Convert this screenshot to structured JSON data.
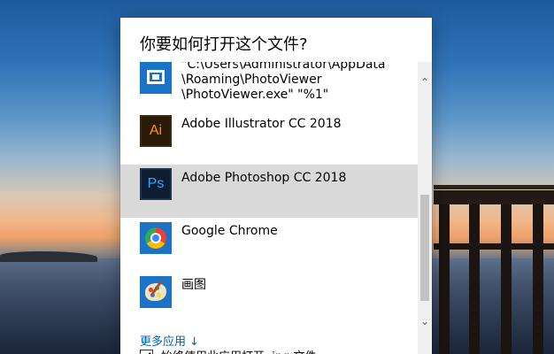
{
  "dialog": {
    "title": "你要如何打开这个文件?",
    "apps": [
      {
        "label_lines": [
          "\"C:\\Users\\Administrator\\AppData",
          "\\Roaming\\PhotoViewer",
          "\\PhotoViewer.exe\" \"%1\""
        ],
        "icon": "photo-viewer-icon",
        "selected": false
      },
      {
        "label": "Adobe Illustrator CC 2018",
        "icon": "illustrator-icon",
        "icon_text": "Ai",
        "selected": false
      },
      {
        "label": "Adobe Photoshop CC 2018",
        "icon": "photoshop-icon",
        "icon_text": "Ps",
        "selected": true
      },
      {
        "label": "Google Chrome",
        "icon": "chrome-icon",
        "selected": false
      },
      {
        "label": "画图",
        "icon": "paint-icon",
        "selected": false
      }
    ],
    "more_apps_link": "更多应用 ↓",
    "always_use_label": "始终使用此应用打开 .jpg 文件",
    "always_use_checked": true
  },
  "colors": {
    "selected_bg": "#d9d9d9",
    "link": "#0063b1",
    "icon_tile": "#1a73c6"
  }
}
